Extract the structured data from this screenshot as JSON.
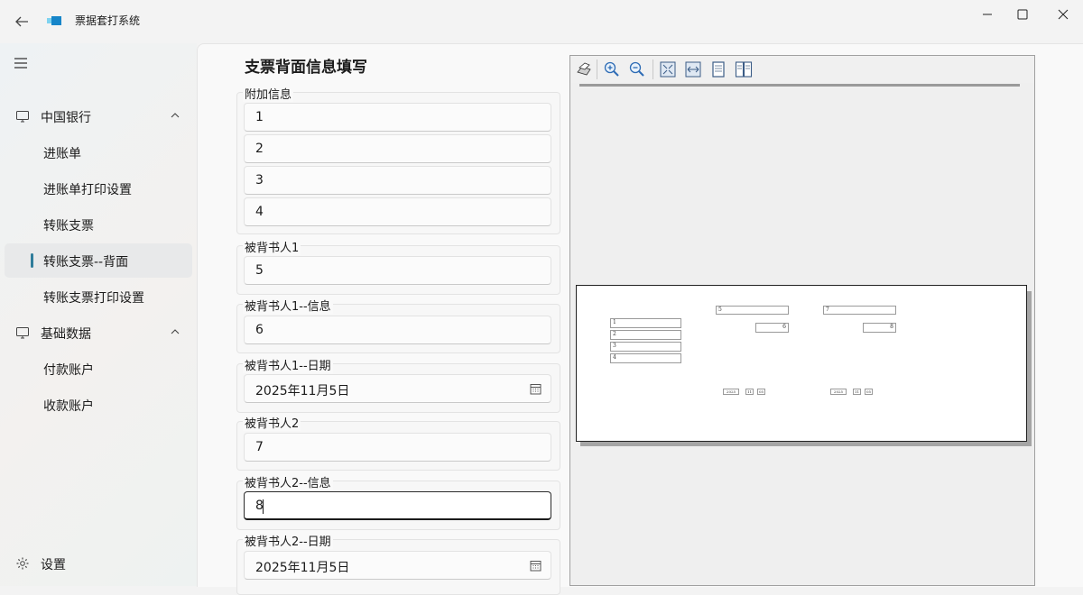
{
  "window": {
    "title": "票据套打系统"
  },
  "sidebar": {
    "groups": [
      {
        "label": "中国银行",
        "items": [
          {
            "label": "进账单"
          },
          {
            "label": "进账单打印设置"
          },
          {
            "label": "转账支票"
          },
          {
            "label": "转账支票--背面"
          },
          {
            "label": "转账支票打印设置"
          }
        ]
      },
      {
        "label": "基础数据",
        "items": [
          {
            "label": "付款账户"
          },
          {
            "label": "收款账户"
          }
        ]
      }
    ],
    "selected": "转账支票--背面",
    "settings_label": "设置"
  },
  "form": {
    "title": "支票背面信息填写",
    "groups": {
      "extra": {
        "label": "附加信息",
        "values": [
          "1",
          "2",
          "3",
          "4"
        ]
      },
      "endorsee1": {
        "label": "被背书人1",
        "value": "5"
      },
      "endorsee1_info": {
        "label": "被背书人1--信息",
        "value": "6"
      },
      "endorsee1_date": {
        "label": "被背书人1--日期",
        "value": "2025年11月5日"
      },
      "endorsee2": {
        "label": "被背书人2",
        "value": "7"
      },
      "endorsee2_info": {
        "label": "被背书人2--信息",
        "value": "8"
      },
      "endorsee2_date": {
        "label": "被背书人2--日期",
        "value": "2025年11月5日"
      }
    }
  },
  "preview": {
    "extra_lines": [
      "1",
      "2",
      "3",
      "4"
    ],
    "endorsee1": "5",
    "endorsee1_info": "6",
    "endorsee2": "7",
    "endorsee2_info": "8",
    "date1": {
      "year": "2025",
      "month": "11",
      "day": "05"
    },
    "date2": {
      "year": "2025",
      "month": "11",
      "day": "05"
    }
  }
}
